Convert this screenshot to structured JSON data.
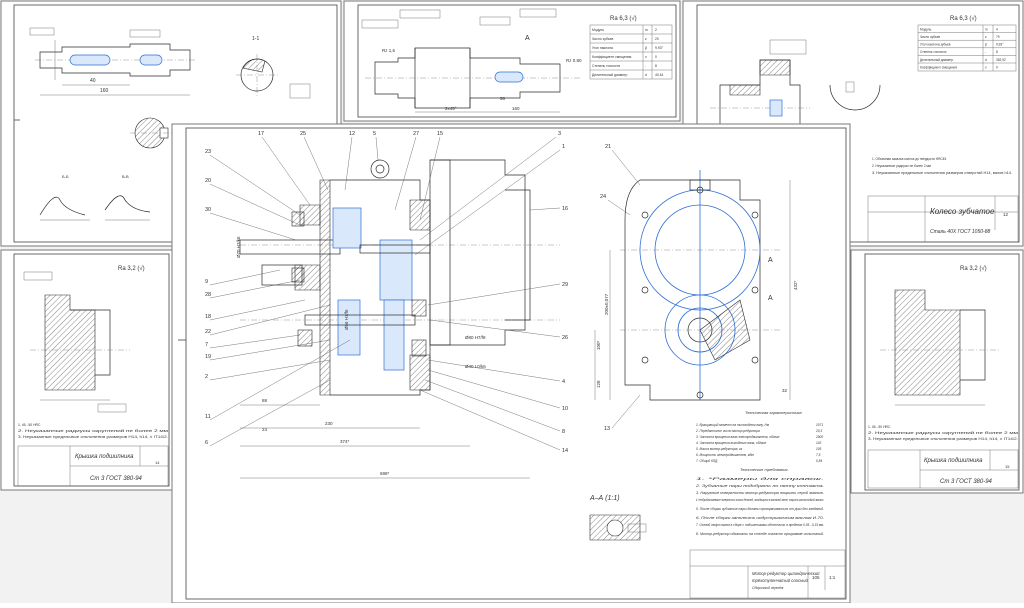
{
  "sheets": {
    "top_left": {
      "labels": [
        "1-1",
        "Б-Б",
        "В-В"
      ],
      "dims": [
        "R1",
        "160",
        "40",
        "R2"
      ]
    },
    "top_middle": {
      "labels": [
        "А"
      ],
      "dims": [
        "2x45°",
        "160",
        "58",
        "Rz 0.80",
        "Rz 1,6"
      ],
      "spec_rough": "Ra 6,3 (√)",
      "spec_rows": [
        {
          "name": "Модуль",
          "sym": "m",
          "val": "2"
        },
        {
          "name": "Число зубьев",
          "sym": "z",
          "val": "20"
        },
        {
          "name": "Угол наклона",
          "sym": "β",
          "val": "9,93°"
        },
        {
          "name": "Коэффициент смещения",
          "sym": "x",
          "val": "0"
        },
        {
          "name": "Степень точности",
          "sym": "-",
          "val": "8"
        },
        {
          "name": "Делительный диаметр",
          "sym": "d",
          "val": "40,61"
        }
      ]
    },
    "top_right": {
      "spec_rough": "Ra 6,3 (√)",
      "spec_rows": [
        {
          "name": "Модуль",
          "sym": "m",
          "val": "4"
        },
        {
          "name": "Число зубьев",
          "sym": "z",
          "val": "79"
        },
        {
          "name": "Угол наклона зубьев",
          "sym": "β",
          "val": "9,93°"
        },
        {
          "name": "Степень точности",
          "sym": "-",
          "val": "8"
        },
        {
          "name": "Делительный диаметр",
          "sym": "d",
          "val": "352,92"
        },
        {
          "name": "Коэффициент смещения",
          "sym": "x",
          "val": "0"
        }
      ],
      "notes": [
        "1. Объемная закалка колеса до твердости НRC45",
        "2. Неуказанные радиусы не более 2 мм",
        "3. Неуказанные предельные отклонения размеров отверстий Н14, валов h14."
      ],
      "title": "Колесо зубчатое",
      "material": "Сталь 40Х ГОСТ 1050-88",
      "sheet_no": "12"
    },
    "left_mid": {
      "rough": "Ra 3,2 (√)",
      "notes": [
        "1. 45...50 HRC",
        "2. Неуказанные радиусы скруглений не более 2 мм",
        "3. Неуказанные предельные отклонения размеров Н14, h14, ± IT14/2."
      ],
      "title": "Крышка подшипника",
      "material": "Ст 3 ГОСТ 380-94",
      "sheet_no": "14"
    },
    "right_mid": {
      "rough": "Ra 3,2 (√)",
      "notes": [
        "1. 45...50 HRC",
        "2. Неуказанные радиусы скруглений не более 2 мм",
        "3. Неуказанные предельные отклонения размеров Н14, h14, ± IT14/2."
      ],
      "title": "Крышка подшипника",
      "material": "Ст 3 ГОСТ 380-94",
      "sheet_no": "15"
    },
    "main": {
      "callouts_left": [
        "23",
        "20",
        "30",
        "9",
        "28",
        "18",
        "22",
        "7",
        "19",
        "2",
        "11",
        "6"
      ],
      "callouts_top": [
        "17",
        "25",
        "12",
        "5",
        "27",
        "15",
        "3",
        "1"
      ],
      "callouts_right": [
        "16",
        "29",
        "26",
        "4",
        "10",
        "8",
        "14"
      ],
      "callout_21": "21",
      "callout_24": "24",
      "callout_13": "13",
      "dims": [
        "230",
        "374*",
        "698*",
        "88",
        "24",
        "Ø80 H7/f8",
        "Ø40 L0/k6",
        "Ø56 H7/f6",
        "Ø70 H7/k6",
        "200±0,077",
        "432*",
        "100*",
        "128",
        "32"
      ],
      "section_label": "А–А (1:1)",
      "section_mark": "А",
      "tech_char_title": "Техническая характеристика",
      "tech_char": [
        {
          "t": "1. Вращающий момент на тихоходном валу, Нм",
          "v": "1071"
        },
        {
          "t": "2. Передаточное число мотор-редуктора",
          "v": "20,3"
        },
        {
          "t": "3. Частота вращения вала электродвигателя, об/мин",
          "v": "2900"
        },
        {
          "t": "4. Частота вращения выходного вала, об/мин",
          "v": "143"
        },
        {
          "t": "5. Масса мотор-редуктора, кг",
          "v": "105"
        },
        {
          "t": "6. Мощность электродвигателя, кВт",
          "v": "7,5"
        },
        {
          "t": "7. Общий КПД",
          "v": "0,84"
        }
      ],
      "tech_req_title": "Технические требования",
      "tech_req": [
        "1. *Размеры для справок.",
        "2. Зубчатые пары подобрать по пятну контакта.",
        "3. Наружные поверхности мотор-редуктора покрыть серой эмалью.",
        "4. Необрабатываемые поверхности литых деталей, находящиеся в масляной ванне, покрыть маслостойкой эмалью.",
        "5. После сборки зубчатые пары должны проворачиваться от руки без заеданий.",
        "6. После сборки заполнить индустриальным маслом И-70.",
        "7. Осевой люфт валов в сборе с подшипниками обеспечить в пределах 0,05...0,15 мм.",
        "8. Мотор-редуктор обкатать на стенде согласно программе испытаний."
      ],
      "title_line1": "Мотор-редуктор цилиндрический",
      "title_line2": "трёхступенчатый соосный",
      "title_line3": "Сборочный чертёж",
      "mass": "105",
      "scale": "1:1"
    }
  }
}
